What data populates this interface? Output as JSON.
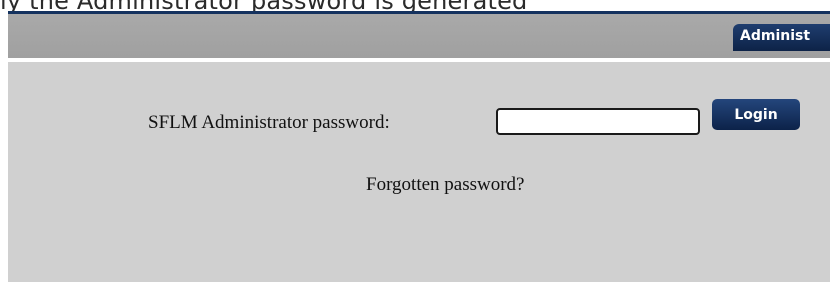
{
  "caption": {
    "text": "ly the Administrator password is generated"
  },
  "header": {
    "admin_tab_label": "Administ"
  },
  "login_form": {
    "password_label": "SFLM Administrator password:",
    "password_value": "",
    "login_button_label": "Login",
    "forgot_link_label": "Forgotten password?"
  },
  "colors": {
    "navy": "#14325f",
    "header_gray": "#a6a6a6",
    "content_gray": "#d0d0d0",
    "button_navy": "#0c2249"
  }
}
